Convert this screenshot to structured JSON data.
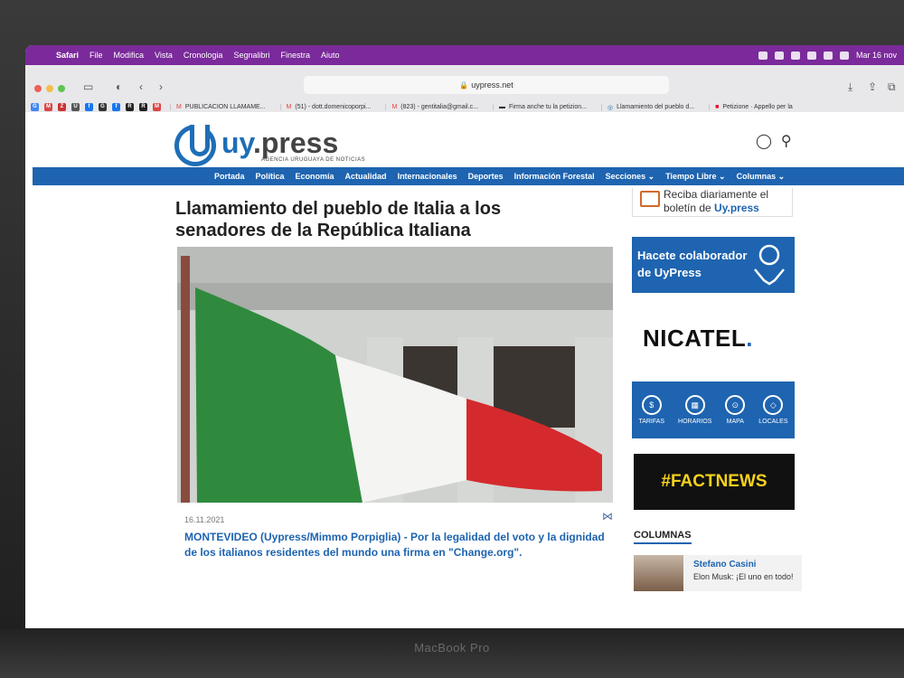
{
  "menubar": {
    "app": "Safari",
    "items": [
      "File",
      "Modifica",
      "Vista",
      "Cronologia",
      "Segnalibri",
      "Finestra",
      "Aiuto"
    ],
    "clock": "Mar 16 nov"
  },
  "browser": {
    "url": "uypress.net",
    "favorites": [
      "G",
      "M",
      "Z",
      "U",
      "f",
      "G",
      "f",
      "R",
      "R",
      "M"
    ],
    "tabs": [
      "PUBLICACION LLAMAME...",
      "(51) - dott.domenicoporpi...",
      "(823) - gentitalia@gmail.c...",
      "Firma anche tu la petizion...",
      "Llamamiento del pueblo d...",
      "Petizione · Appello per la"
    ]
  },
  "site": {
    "logo_main": "uy",
    "logo_suffix": ".press",
    "logo_tagline": "AGENCIA URUGUAYA DE NOTICIAS",
    "nav": [
      "Portada",
      "Política",
      "Economía",
      "Actualidad",
      "Internacionales",
      "Deportes",
      "Información Forestal",
      "Secciones ⌄",
      "Tiempo Libre ⌄",
      "Columnas ⌄"
    ]
  },
  "article": {
    "title": "Llamamiento del pueblo de Italia a los senadores de la República Italiana",
    "date": "16.11.2021",
    "lead": "MONTEVIDEO (Uypress/Mimmo Porpiglia) - Por la legalidad del voto y la dignidad de los italianos residentes del mundo una firma en \"Change.org\"."
  },
  "sidebar": {
    "newsletter_line1": "Reciba diariamente el",
    "newsletter_line2_pre": "boletín de ",
    "newsletter_line2_brand": "Uy.press",
    "colab_line1": "Hacete colaborador",
    "colab_line2": "de UyPress",
    "nicatel_main": "NICATEL",
    "nicatel_dot": ".",
    "services": [
      "TARIFAS",
      "HORARIOS",
      "MAPA",
      "LOCALES"
    ],
    "factnews": "#FACTNEWS",
    "columns_title": "COLUMNAS",
    "columnist_name": "Stefano Casini",
    "columnist_text": "Elon Musk: ¡El uno en todo!"
  },
  "laptop_label": "MacBook Pro"
}
